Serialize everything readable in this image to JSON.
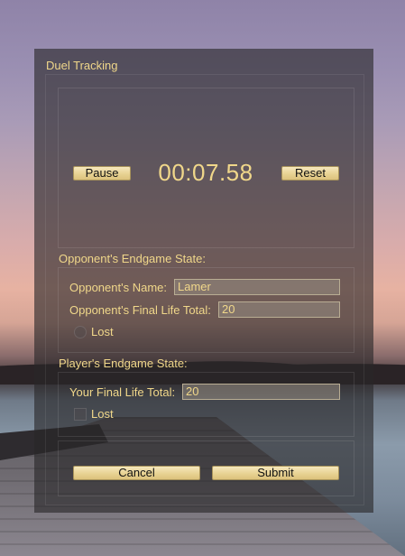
{
  "dialog": {
    "title": "Duel Tracking"
  },
  "timer": {
    "pause_label": "Pause",
    "display": "00:07.58",
    "reset_label": "Reset"
  },
  "opponent": {
    "section_title": "Opponent's Endgame State:",
    "name_label": "Opponent's Name:",
    "name_value": "Lamer",
    "life_label": "Opponent's Final Life Total:",
    "life_value": "20",
    "lost_label": "Lost"
  },
  "player": {
    "section_title": "Player's Endgame State:",
    "life_label": "Your Final Life Total:",
    "life_value": "20",
    "lost_label": "Lost"
  },
  "actions": {
    "cancel_label": "Cancel",
    "submit_label": "Submit"
  },
  "colors": {
    "accent_text": "#f0d78a",
    "button_face": "#e8d293",
    "panel_background": "rgba(40,38,40,0.62)"
  }
}
